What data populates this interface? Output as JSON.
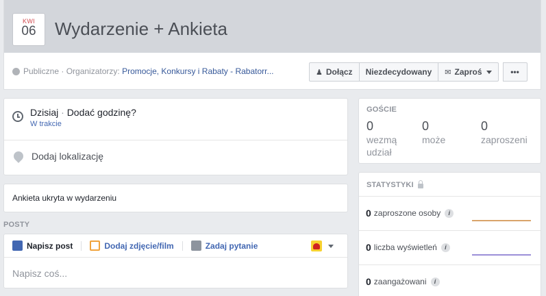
{
  "header": {
    "date_month": "KWI",
    "date_day": "06",
    "title": "Wydarzenie + Ankieta",
    "meta_prefix": "Publiczne · Organizatorzy:",
    "organizer": "Promocje, Konkursy i Rabaty - Rabatorr...",
    "actions": {
      "join": "Dołącz",
      "maybe": "Niezdecydowany",
      "invite": "Zaproś",
      "more": "•••"
    }
  },
  "time": {
    "day": "Dzisiaj",
    "separator": "·",
    "add_time": "Dodać godzinę?",
    "status": "W trakcie"
  },
  "location": {
    "label": "Dodaj lokalizację"
  },
  "poll": {
    "label": "Ankieta ukryta w wydarzeniu"
  },
  "posts": {
    "section_label": "POSTY",
    "tabs": [
      {
        "label": "Napisz post"
      },
      {
        "label": "Dodaj zdjęcie/film"
      },
      {
        "label": "Zadaj pytanie"
      }
    ],
    "placeholder": "Napisz coś..."
  },
  "guests": {
    "title": "GOŚCIE",
    "stats": [
      {
        "count": "0",
        "label_line1": "wezmą",
        "label_line2": "udział"
      },
      {
        "count": "0",
        "label_line1": "może",
        "label_line2": ""
      },
      {
        "count": "0",
        "label_line1": "zaproszeni",
        "label_line2": ""
      }
    ]
  },
  "statistics": {
    "title": "STATYSTYKI",
    "rows": [
      {
        "value": "0",
        "label": "zaproszone osoby",
        "info": "i",
        "line_color": "#d9a46a"
      },
      {
        "value": "0",
        "label": "liczba wyświetleń",
        "info": "i",
        "line_color": "#9b8fd8"
      },
      {
        "value": "0",
        "label": "zaangażowani",
        "info": "i",
        "line_color": "#9b8fd8"
      }
    ]
  },
  "colors": {
    "link": "#365899",
    "accent": "#4267b2",
    "date_red": "#d0494e"
  }
}
